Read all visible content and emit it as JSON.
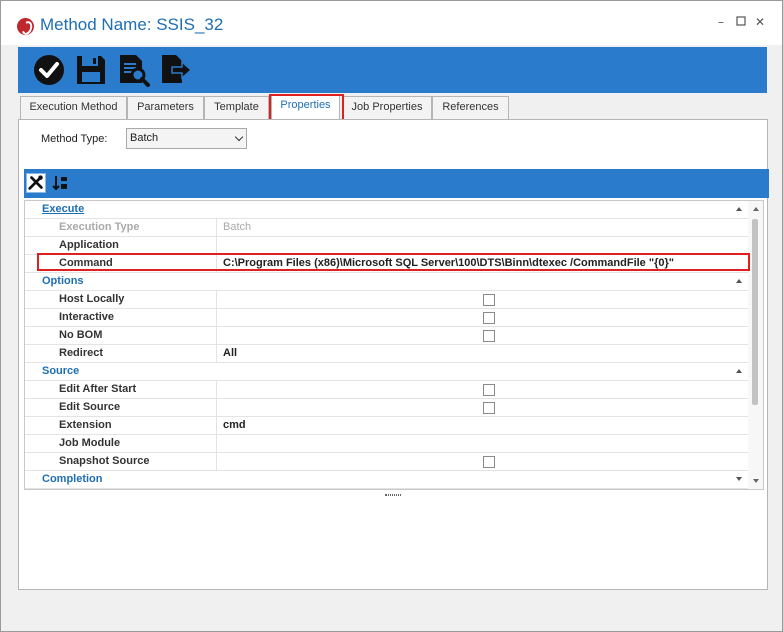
{
  "window": {
    "title": "Method Name: SSIS_32",
    "controls": [
      "minimize-icon",
      "maximize-icon",
      "close-icon"
    ]
  },
  "toolbar": {
    "buttons": [
      {
        "name": "save-and-close-button",
        "icon": "check-circle-icon"
      },
      {
        "name": "save-button",
        "icon": "floppy-disk-icon"
      },
      {
        "name": "preview-button",
        "icon": "document-search-icon"
      },
      {
        "name": "export-button",
        "icon": "document-export-icon"
      }
    ],
    "color": "#2b7bcd"
  },
  "tabs": [
    {
      "label": "Execution Method"
    },
    {
      "label": "Parameters"
    },
    {
      "label": "Template"
    },
    {
      "label": "Properties",
      "active": true
    },
    {
      "label": "Job Properties"
    },
    {
      "label": "References"
    }
  ],
  "method_type": {
    "label": "Method Type:",
    "value": "Batch"
  },
  "grid": {
    "categories": [
      {
        "label": "Execute",
        "rows": [
          {
            "name": "Execution Type",
            "value": "Batch",
            "disabled": true
          },
          {
            "name": "Application",
            "value": ""
          },
          {
            "name": "Command",
            "value": "C:\\Program Files (x86)\\Microsoft SQL Server\\100\\DTS\\Binn\\dtexec /CommandFile \"{0}\""
          }
        ]
      },
      {
        "label": "Options",
        "rows": [
          {
            "name": "Host Locally",
            "checkbox": true
          },
          {
            "name": "Interactive",
            "checkbox": true
          },
          {
            "name": "No BOM",
            "checkbox": true
          },
          {
            "name": "Redirect",
            "value": "All"
          }
        ]
      },
      {
        "label": "Source",
        "rows": [
          {
            "name": "Edit After Start",
            "checkbox": true
          },
          {
            "name": "Edit Source",
            "checkbox": true
          },
          {
            "name": "Extension",
            "value": "cmd"
          },
          {
            "name": "Job Module",
            "value": ""
          },
          {
            "name": "Snapshot Source",
            "checkbox": true
          }
        ]
      },
      {
        "label": "Completion",
        "rows": []
      }
    ]
  },
  "colors": {
    "accent": "#2b7bcd",
    "highlight": "#e02020",
    "category_text": "#1e6eb4"
  }
}
